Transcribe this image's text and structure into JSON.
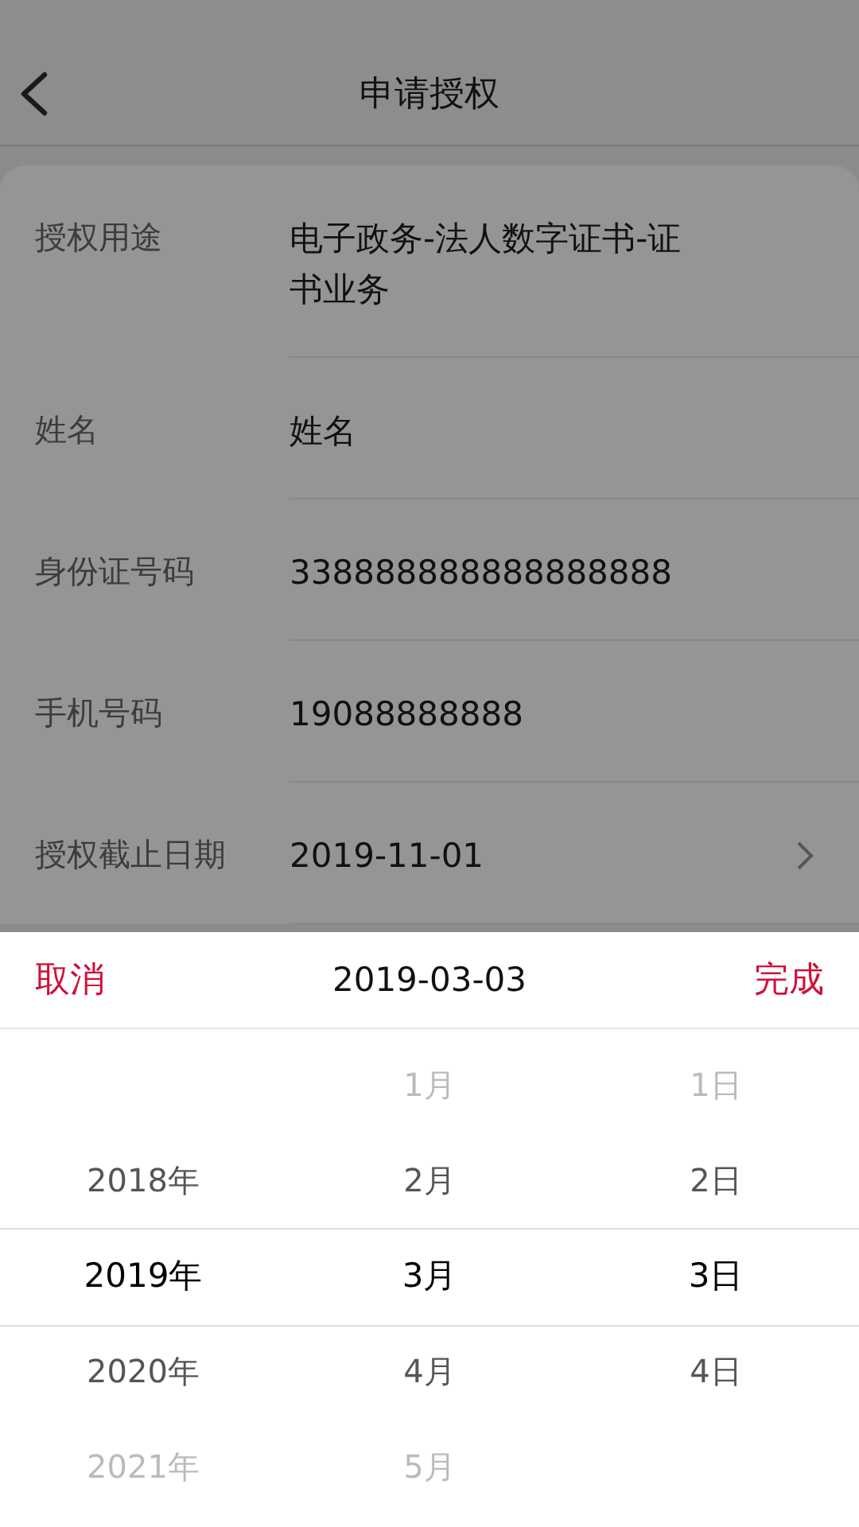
{
  "header": {
    "title": "申请授权"
  },
  "fields": [
    {
      "label": "授权用途",
      "value": "电子政务-法人数字证书-证书业务",
      "chevron": false
    },
    {
      "label": "姓名",
      "value": "姓名",
      "chevron": false
    },
    {
      "label": "身份证号码",
      "value": "338888888888888888",
      "chevron": false
    },
    {
      "label": "手机号码",
      "value": "19088888888",
      "chevron": false
    },
    {
      "label": "授权截止日期",
      "value": "2019-11-01",
      "chevron": true
    }
  ],
  "picker": {
    "cancel": "取消",
    "title": "2019-03-03",
    "done": "完成",
    "columns": [
      {
        "items": [
          {
            "text": "2018年",
            "selected": false
          },
          {
            "text": "2019年",
            "selected": true
          },
          {
            "text": "2020年",
            "selected": false
          },
          {
            "text": "2021年",
            "selected": false
          }
        ]
      },
      {
        "items": [
          {
            "text": "1月",
            "selected": false
          },
          {
            "text": "2月",
            "selected": false
          },
          {
            "text": "3月",
            "selected": true
          },
          {
            "text": "4月",
            "selected": false
          },
          {
            "text": "5月",
            "selected": false
          }
        ]
      },
      {
        "items": [
          {
            "text": "1日",
            "selected": false
          },
          {
            "text": "2日",
            "selected": false
          },
          {
            "text": "3日",
            "selected": true
          },
          {
            "text": "4日",
            "selected": false
          }
        ]
      }
    ]
  }
}
